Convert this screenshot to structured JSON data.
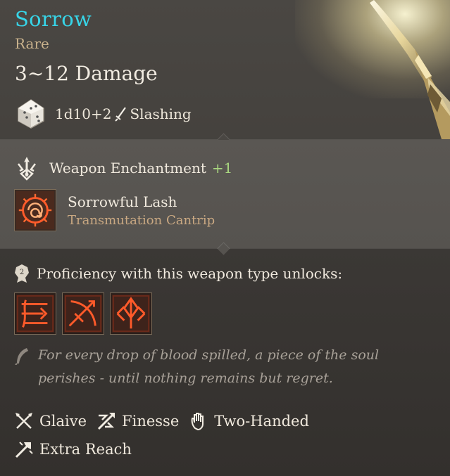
{
  "item": {
    "name": "Sorrow",
    "rarity": "Rare",
    "damage_range": "3~12 Damage",
    "damage_dice": "1d10+2",
    "damage_type": "Slashing"
  },
  "enchantment": {
    "label": "Weapon Enchantment",
    "bonus": "+1"
  },
  "spell": {
    "name": "Sorrowful Lash",
    "school": "Transmutation Cantrip",
    "icon": "spiral-sigil-icon"
  },
  "proficiency": {
    "label": "Proficiency with this weapon type unlocks:",
    "actions": [
      {
        "icon": "cleave-glyph-icon"
      },
      {
        "icon": "bow-strike-glyph-icon"
      },
      {
        "icon": "spear-thrust-glyph-icon"
      }
    ]
  },
  "flavor_text": "For every drop of blood spilled, a piece of the soul perishes - until nothing remains but regret.",
  "properties": [
    {
      "label": "Glaive",
      "icon": "glaive-icon"
    },
    {
      "label": "Finesse",
      "icon": "finesse-icon"
    },
    {
      "label": "Two-Handed",
      "icon": "hand-icon"
    },
    {
      "label": "Extra Reach",
      "icon": "extra-reach-icon"
    }
  ],
  "colors": {
    "title": "#37d5e8",
    "rarity": "#c9b28c",
    "bonus": "#a9d780",
    "spell_school": "#c9a882",
    "flavor": "#a8a198",
    "rune": "#ff5a2a"
  }
}
